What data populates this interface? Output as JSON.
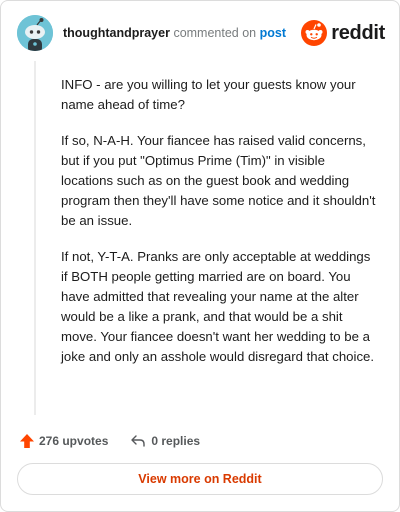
{
  "header": {
    "username": "thoughtandprayer",
    "action": "commented on",
    "post_link": "post",
    "brand": "reddit"
  },
  "comment": {
    "paragraphs": [
      "INFO - are you willing to let your guests know your name ahead of time?",
      "If so, N-A-H. Your fiancee has raised valid concerns, but if you put \"Optimus Prime (Tim)\" in visible locations such as on the guest book and wedding program then they'll have some notice and it shouldn't be an issue.",
      "If not, Y-T-A. Pranks are only acceptable at weddings if BOTH people getting married are on board. You have admitted that revealing your name at the alter would be a like a prank, and that would be a shit move. Your fiancee doesn't want her wedding to be a joke and only an asshole would disregard that choice."
    ]
  },
  "actions": {
    "upvotes": "276 upvotes",
    "replies": "0 replies"
  },
  "footer": {
    "view_more": "View more on Reddit"
  },
  "colors": {
    "brand": "#ff4500",
    "link": "#0079d3",
    "view_more": "#d93a00",
    "avatar_bg": "#6ec3d6"
  },
  "icons": {
    "avatar": "snoo-avatar",
    "brand": "reddit-logo-icon",
    "upvote": "upvote-arrow-icon",
    "reply": "reply-arrow-icon"
  }
}
